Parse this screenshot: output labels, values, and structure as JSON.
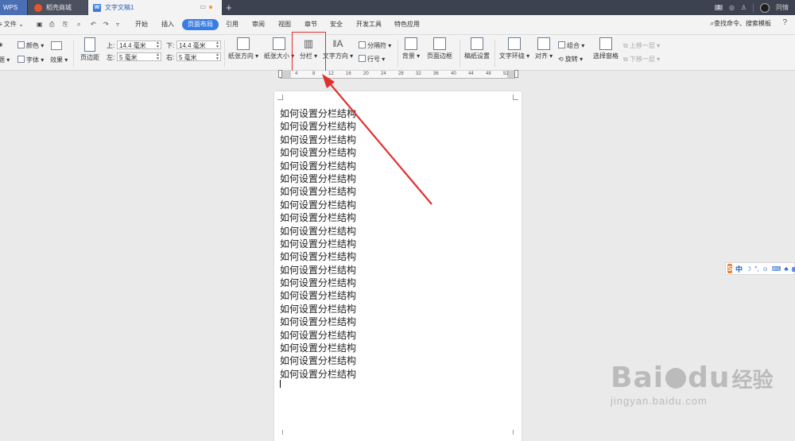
{
  "titlebar": {
    "tabs": [
      "WPS",
      "稻壳商城",
      "文字文稿1"
    ],
    "new_tab": "+",
    "badge": "1",
    "user": "同情"
  },
  "menubar": {
    "file": "≡ 文件 ⌄",
    "items": [
      "开始",
      "插入",
      "页面布局",
      "引用",
      "审阅",
      "视图",
      "章节",
      "安全",
      "开发工具",
      "特色应用"
    ],
    "active": "页面布局",
    "search": "查找命令、搜索模板",
    "help": "?"
  },
  "ribbon": {
    "theme_color": "颜色",
    "theme_font": "字体",
    "theme_effect": "效果",
    "theme": "题",
    "margins": "页边距",
    "top_label": "上:",
    "bottom_label": "下:",
    "left_label": "左:",
    "right_label": "右:",
    "top_value": "14.4 毫米",
    "bottom_value": "14.4 毫米",
    "left_value": "5 毫米",
    "right_value": "5 毫米",
    "orientation": "纸张方向",
    "size": "纸张大小",
    "columns": "分栏",
    "text_direction": "文字方向",
    "separator": "分隔符",
    "line_number": "行号",
    "background": "背景",
    "page_border": "页面边框",
    "paper_setup": "稿纸设置",
    "text_wrap": "文字环绕",
    "align": "对齐",
    "group": "组合",
    "rotate": "旋转",
    "selection_pane": "选择窗格",
    "bring_forward": "上移一层",
    "send_backward": "下移一层"
  },
  "ruler": {
    "ticks": [
      "4",
      "8",
      "12",
      "16",
      "20",
      "24",
      "28",
      "32",
      "36",
      "40",
      "44",
      "48",
      "52"
    ]
  },
  "document": {
    "lines": [
      "如何设置分栏结构",
      "如何设置分栏结构",
      "如何设置分栏结构",
      "如何设置分栏结构",
      "如何设置分栏结构",
      "如何设置分栏结构",
      "如何设置分栏结构",
      "如何设置分栏结构",
      "如何设置分栏结构",
      "如何设置分栏结构",
      "如何设置分栏结构",
      "如何设置分栏结构",
      "如何设置分栏结构",
      "如何设置分栏结构",
      "如何设置分栏结构",
      "如何设置分栏结构",
      "如何设置分栏结构",
      "如何设置分栏结构",
      "如何设置分栏结构",
      "如何设置分栏结构",
      "如何设置分栏结构"
    ]
  },
  "ime": {
    "logo": "S",
    "mode": "中"
  },
  "watermark": {
    "brand": "Bai",
    "brand2": "du",
    "cn": "经验",
    "url": "jingyan.baidu.com"
  },
  "colors": {
    "accent": "#3a7de0",
    "annotation": "#e0302e",
    "titlebar": "#3d4250"
  }
}
